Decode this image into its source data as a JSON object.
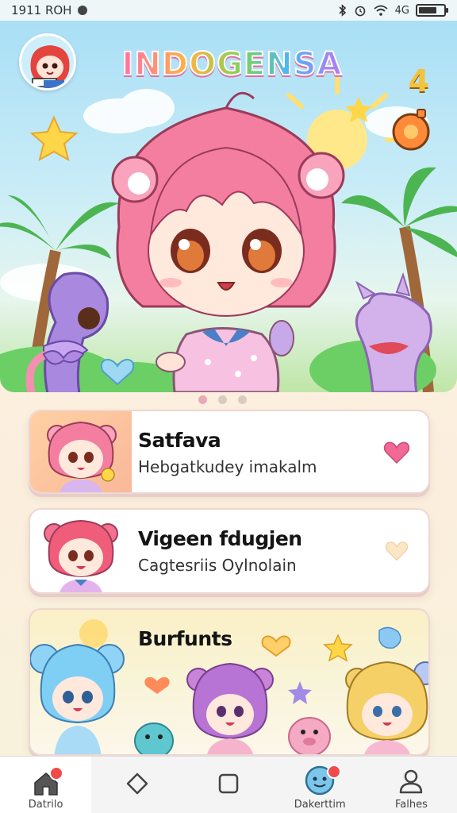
{
  "status_bar": {
    "time": "1911 ROH",
    "indicators": [
      "bluetooth-icon",
      "alarm-icon",
      "wifi-icon"
    ],
    "signal_text": "4G",
    "battery_level": 0.72
  },
  "hero": {
    "app_title": "INDOGENSA",
    "corner_badge": "4",
    "pager_active_index": 0,
    "pager_count": 3
  },
  "cards": [
    {
      "title": "Satfava",
      "subtitle": "Hebgatkudey imakalm",
      "favorite_icon": "heart-icon",
      "favorite_active": true
    },
    {
      "title": "Vigeen fdugjen",
      "subtitle": "Cagtesriis Oylnolain",
      "favorite_icon": "heart-icon",
      "favorite_active": false
    },
    {
      "title": "Burfunts"
    }
  ],
  "bottom_nav": [
    {
      "label": "Datrilo",
      "icon": "home-icon",
      "badge": true,
      "active": true
    },
    {
      "label": "",
      "icon": "diamond-icon",
      "badge": false,
      "active": false
    },
    {
      "label": "",
      "icon": "square-icon",
      "badge": false,
      "active": false
    },
    {
      "label": "Dakerttim",
      "icon": "globe-face-icon",
      "badge": true,
      "active": false
    },
    {
      "label": "Falhes",
      "icon": "profile-icon",
      "badge": false,
      "active": false
    }
  ],
  "colors": {
    "accent_pink": "#f06a95",
    "badge_red": "#f04a4a",
    "card_border": "#edd7d2",
    "sky": "#a9dff5"
  }
}
